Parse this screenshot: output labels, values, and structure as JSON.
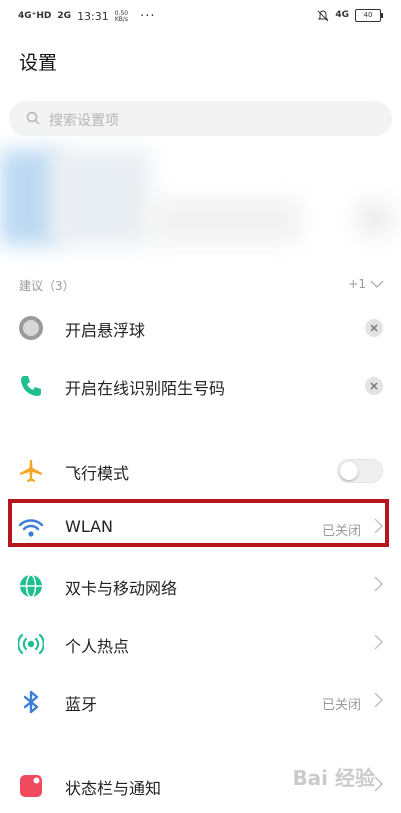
{
  "status_bar": {
    "network_1": "4G⁺HD",
    "network_2": "2G",
    "time": "13:31",
    "speed_value": "0.50",
    "speed_unit": "KB/s",
    "more": "···",
    "network_right": "4G",
    "battery": "40"
  },
  "header": {
    "title": "设置"
  },
  "search": {
    "placeholder": "搜索设置项"
  },
  "suggestions": {
    "header": "建议（3）",
    "count_right": "+1",
    "items": [
      {
        "label": "开启悬浮球"
      },
      {
        "label": "开启在线识别陌生号码"
      }
    ]
  },
  "settings": {
    "items": [
      {
        "label": "飞行模式",
        "toggle_on": false
      },
      {
        "label": "WLAN",
        "value": "已关闭"
      },
      {
        "label": "双卡与移动网络"
      },
      {
        "label": "个人热点"
      },
      {
        "label": "蓝牙",
        "value": "已关闭"
      },
      {
        "label": "状态栏与通知"
      }
    ]
  },
  "colors": {
    "airplane": "#f5a623",
    "wlan": "#3b7dd8",
    "sim": "#1fbf8f",
    "hotspot": "#1fbf8f",
    "bluetooth": "#3b7dd8",
    "statusbar": "#ef4a5e",
    "highlight": "#b3161b"
  },
  "watermark": "Bai 经验"
}
